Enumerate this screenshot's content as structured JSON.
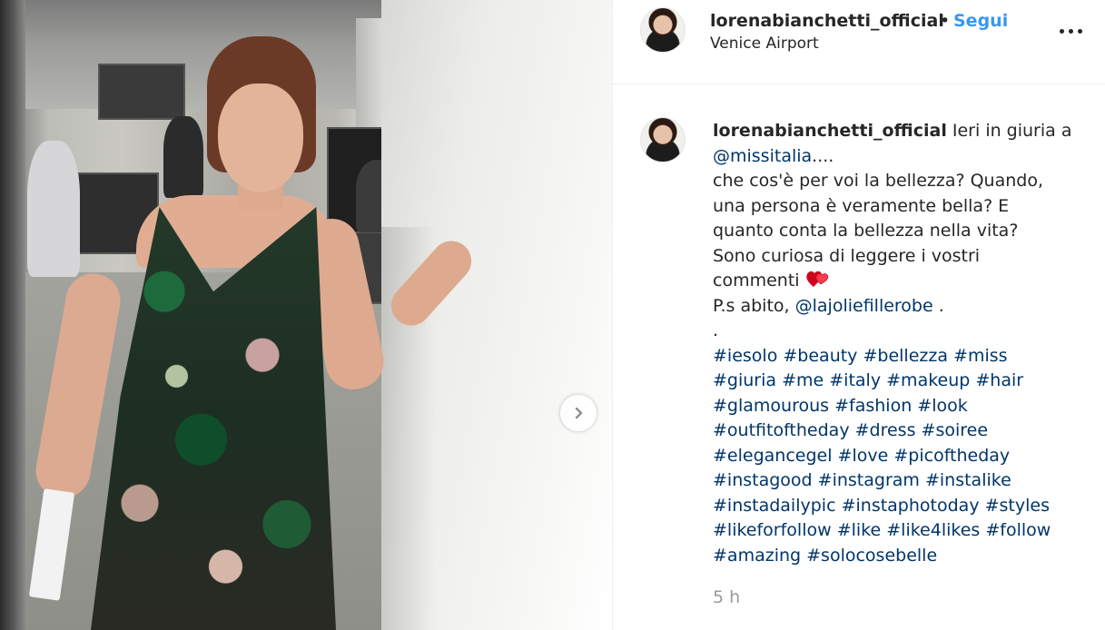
{
  "post": {
    "username": "lorenabianchetti_official",
    "follow_label": "Segui",
    "separator": "•",
    "location": "Venice Airport",
    "caption": {
      "line1_text": "Ieri in giuria a",
      "mention1": "@missitalia",
      "line2_suffix": "....",
      "line3": "che cos'è per voi la bellezza? Quando,",
      "line4": "una persona è veramente bella? E",
      "line5": "quanto conta la bellezza nella vita?",
      "line6": "Sono curiosa di leggere i vostri",
      "line7": "commenti",
      "emoji": "two-hearts",
      "line8_prefix": "P.s abito,",
      "mention2": "@lajoliefillerobe",
      "line8_suffix": " .",
      "line9": ".",
      "hashtag_lines": [
        [
          "#iesolo",
          "#beauty",
          "#bellezza",
          "#miss"
        ],
        [
          "#giuria",
          "#me",
          "#italy",
          "#makeup",
          "#hair"
        ],
        [
          "#glamourous",
          "#fashion",
          "#look"
        ],
        [
          "#outfitoftheday",
          "#dress",
          "#soiree"
        ],
        [
          "#elegancegel",
          "#love",
          "#picoftheday"
        ],
        [
          "#instagood",
          "#instagram",
          "#instalike"
        ],
        [
          "#instadailypic",
          "#instaphotoday",
          "#styles"
        ],
        [
          "#likeforfollow",
          "#like",
          "#like4likes",
          "#follow"
        ],
        [
          "#amazing",
          "#solocosebelle"
        ]
      ]
    },
    "time_ago": "5 h"
  },
  "icons": {
    "more": "more-options-icon",
    "next": "chevron-right-icon",
    "heart": "two-hearts-emoji"
  },
  "colors": {
    "link": "#003569",
    "follow": "#3897f0",
    "text": "#262626",
    "muted": "#999999"
  }
}
